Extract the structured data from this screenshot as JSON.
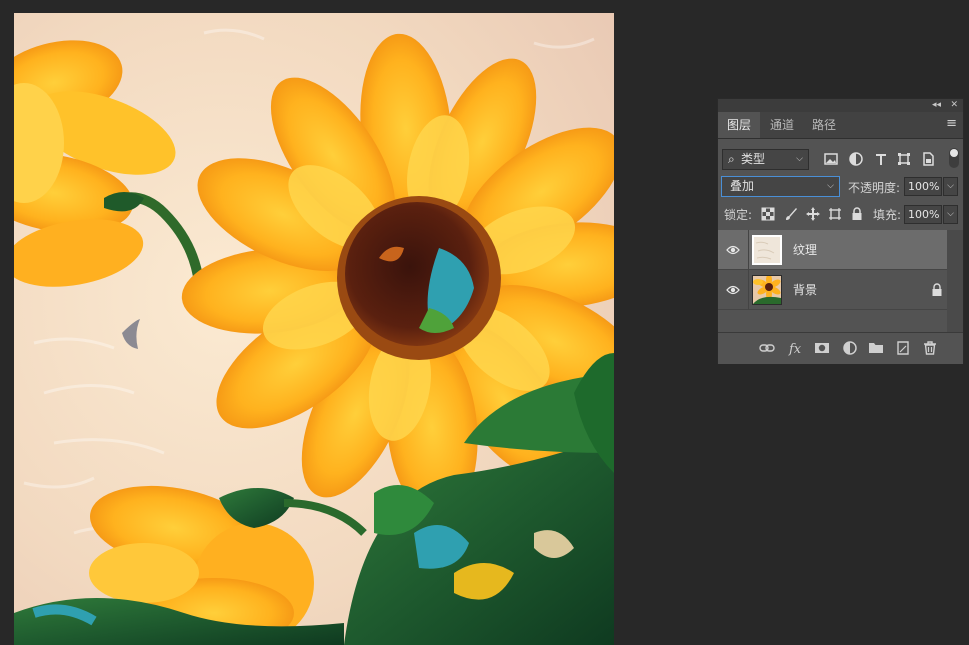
{
  "canvas": {
    "image": "sunflower-oil-painting"
  },
  "panel": {
    "tabs": [
      "图层",
      "通道",
      "路径"
    ],
    "active_tab": "图层",
    "filter": {
      "kind_label": "类型"
    },
    "filter_icons": [
      "image-filter-icon",
      "adjustment-filter-icon",
      "type-filter-icon",
      "shape-filter-icon",
      "smart-object-filter-icon"
    ],
    "blend_mode": "叠加",
    "opacity_label": "不透明度:",
    "opacity_value": "100%",
    "lock_label": "锁定:",
    "fill_label": "填充:",
    "fill_value": "100%",
    "layers": [
      {
        "name": "纹理",
        "visible": true,
        "selected": true,
        "locked": false
      },
      {
        "name": "背景",
        "visible": true,
        "selected": false,
        "locked": true
      }
    ],
    "footer_icons": [
      "link-layers-icon",
      "fx-icon",
      "add-mask-icon",
      "adjustment-layer-icon",
      "new-group-icon",
      "new-layer-icon",
      "delete-icon"
    ],
    "colors": {
      "panel_bg": "#535353",
      "selected_layer": "#6c6c6c",
      "blend_border": "#4a8fd6"
    }
  }
}
